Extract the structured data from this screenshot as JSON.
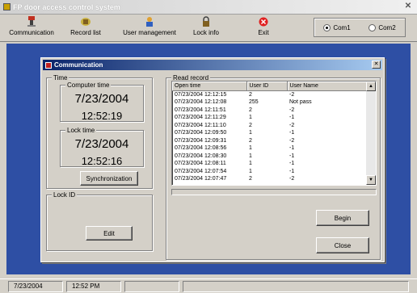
{
  "window": {
    "title": "FP door access control system"
  },
  "toolbar": {
    "items": [
      {
        "label": "Communication",
        "icon": "communication-icon"
      },
      {
        "label": "Record list",
        "icon": "record-list-icon"
      },
      {
        "label": "User management",
        "icon": "user-management-icon"
      },
      {
        "label": "Lock info",
        "icon": "lock-info-icon"
      },
      {
        "label": "Exit",
        "icon": "exit-icon"
      }
    ],
    "com_ports": [
      {
        "label": "Com1",
        "selected": true
      },
      {
        "label": "Com2",
        "selected": false
      }
    ]
  },
  "dialog": {
    "title": "Communication",
    "time_group": "Time",
    "computer_time": {
      "label": "Computer time",
      "date": "7/23/2004",
      "time": "12:52:19"
    },
    "lock_time": {
      "label": "Lock time",
      "date": "7/23/2004",
      "time": "12:52:16"
    },
    "sync_button": "Synchronization",
    "lock_id_group": "Lock ID",
    "edit_button": "Edit",
    "read_record_group": "Read record",
    "records": {
      "columns": [
        "Open time",
        "User ID",
        "User Name"
      ],
      "rows": [
        [
          "07/23/2004 12:12:15",
          "2",
          "-2"
        ],
        [
          "07/23/2004 12:12:08",
          "255",
          "Not pass"
        ],
        [
          "07/23/2004 12:11:51",
          "2",
          "-2"
        ],
        [
          "07/23/2004 12:11:29",
          "1",
          "-1"
        ],
        [
          "07/23/2004 12:11:10",
          "2",
          "-2"
        ],
        [
          "07/23/2004 12:09:50",
          "1",
          "-1"
        ],
        [
          "07/23/2004 12:09:31",
          "2",
          "-2"
        ],
        [
          "07/23/2004 12:08:56",
          "1",
          "-1"
        ],
        [
          "07/23/2004 12:08:30",
          "1",
          "-1"
        ],
        [
          "07/23/2004 12:08:11",
          "1",
          "-1"
        ],
        [
          "07/23/2004 12:07:54",
          "1",
          "-1"
        ],
        [
          "07/23/2004 12:07:47",
          "2",
          "-2"
        ]
      ]
    },
    "begin_button": "Begin",
    "close_button": "Close"
  },
  "statusbar": {
    "date": "7/23/2004",
    "time": "12:52 PM"
  },
  "colors": {
    "workspace": "#2e4fa4",
    "dialog_title": "#0a246a",
    "exit_icon": "#e02020"
  }
}
